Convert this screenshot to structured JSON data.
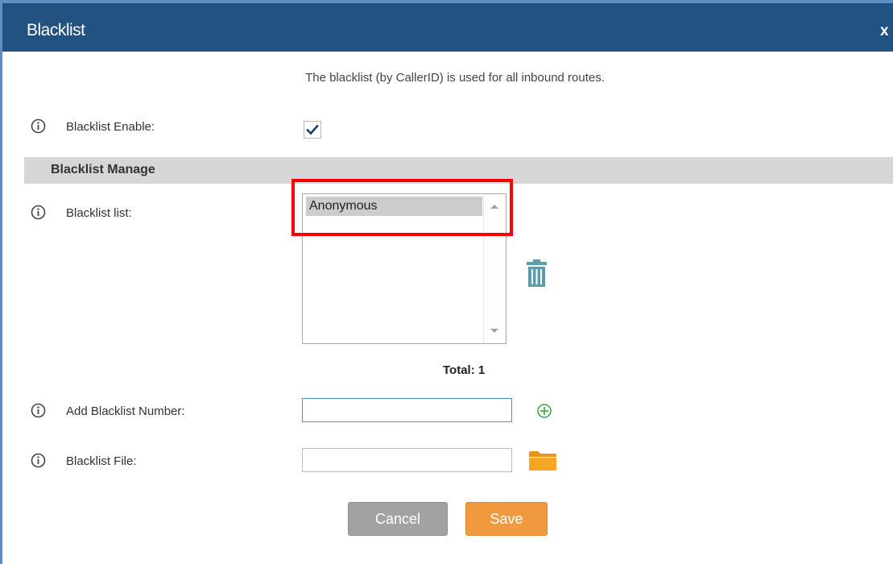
{
  "dialog": {
    "title": "Blacklist",
    "close_label": "x",
    "description": "The blacklist (by CallerID) is used for all inbound routes."
  },
  "fields": {
    "enable_label": "Blacklist Enable:",
    "enable_checked": true,
    "section_title": "Blacklist Manage",
    "list_label": "Blacklist list:",
    "list_items": [
      "Anonymous"
    ],
    "total_text": "Total: 1",
    "add_number_label": "Add Blacklist Number:",
    "add_number_value": "",
    "file_label": "Blacklist File:",
    "file_value": ""
  },
  "buttons": {
    "cancel": "Cancel",
    "save": "Save"
  },
  "icons": {
    "info": "info-circle-icon",
    "check": "checkmark-icon",
    "trash": "trash-icon",
    "add": "plus-circle-icon",
    "folder": "folder-icon"
  },
  "colors": {
    "titlebar": "#215282",
    "section_bg": "#d6d6d6",
    "highlight": "#ff0000",
    "save_button": "#f0993f",
    "cancel_button": "#a2a2a2",
    "icon_teal": "#5b9eaa",
    "add_icon": "#3ca63c",
    "folder": "#f5a623"
  }
}
